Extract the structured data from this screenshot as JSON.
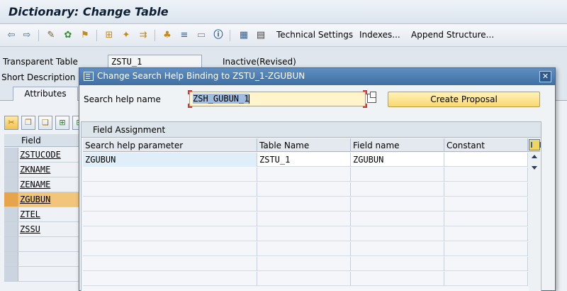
{
  "window": {
    "title": "Dictionary: Change Table"
  },
  "toolbar": {
    "technical_settings": "Technical Settings",
    "indexes": "Indexes...",
    "append_structure": "Append Structure...",
    "icons": [
      "back-arrow-icon",
      "forward-arrow-icon",
      "display-change-icon",
      "other-object-icon",
      "activate-icon",
      "where-used-icon",
      "hierarchy-icon",
      "magic-wand-icon",
      "transport-icon",
      "object-list-icon",
      "navigation-icon",
      "documentation-icon",
      "info-icon",
      "contents-icon",
      "grid-icon"
    ]
  },
  "header": {
    "transparent_table_label": "Transparent Table",
    "transparent_table_value": "ZSTU_1",
    "status": "Inactive(Revised)",
    "short_description_label": "Short Description"
  },
  "tabs": {
    "attributes": "Attributes"
  },
  "background_table": {
    "column_header": "Field",
    "rows": [
      "ZSTUCODE",
      "ZKNAME",
      "ZENAME",
      "ZGUBUN",
      "ZTEL",
      "ZSSU"
    ],
    "highlighted_row": "ZGUBUN"
  },
  "dialog": {
    "title": "Change Search Help Binding to ZSTU_1-ZGUBUN",
    "search_help_label": "Search help name",
    "search_help_value": "ZSH_GUBUN_1",
    "create_proposal": "Create Proposal",
    "field_assignment_title": "Field Assignment",
    "columns": [
      "Search help parameter",
      "Table Name",
      "Field name",
      "Constant"
    ],
    "rows": [
      {
        "parameter": "ZGUBUN",
        "table": "ZSTU_1",
        "field": "ZGUBUN",
        "constant": ""
      }
    ]
  },
  "colors": {
    "accent": "#3f6fa3",
    "selection": "#f1c57a",
    "input_background": "#fff4cc",
    "button_background": "#f8d871"
  }
}
